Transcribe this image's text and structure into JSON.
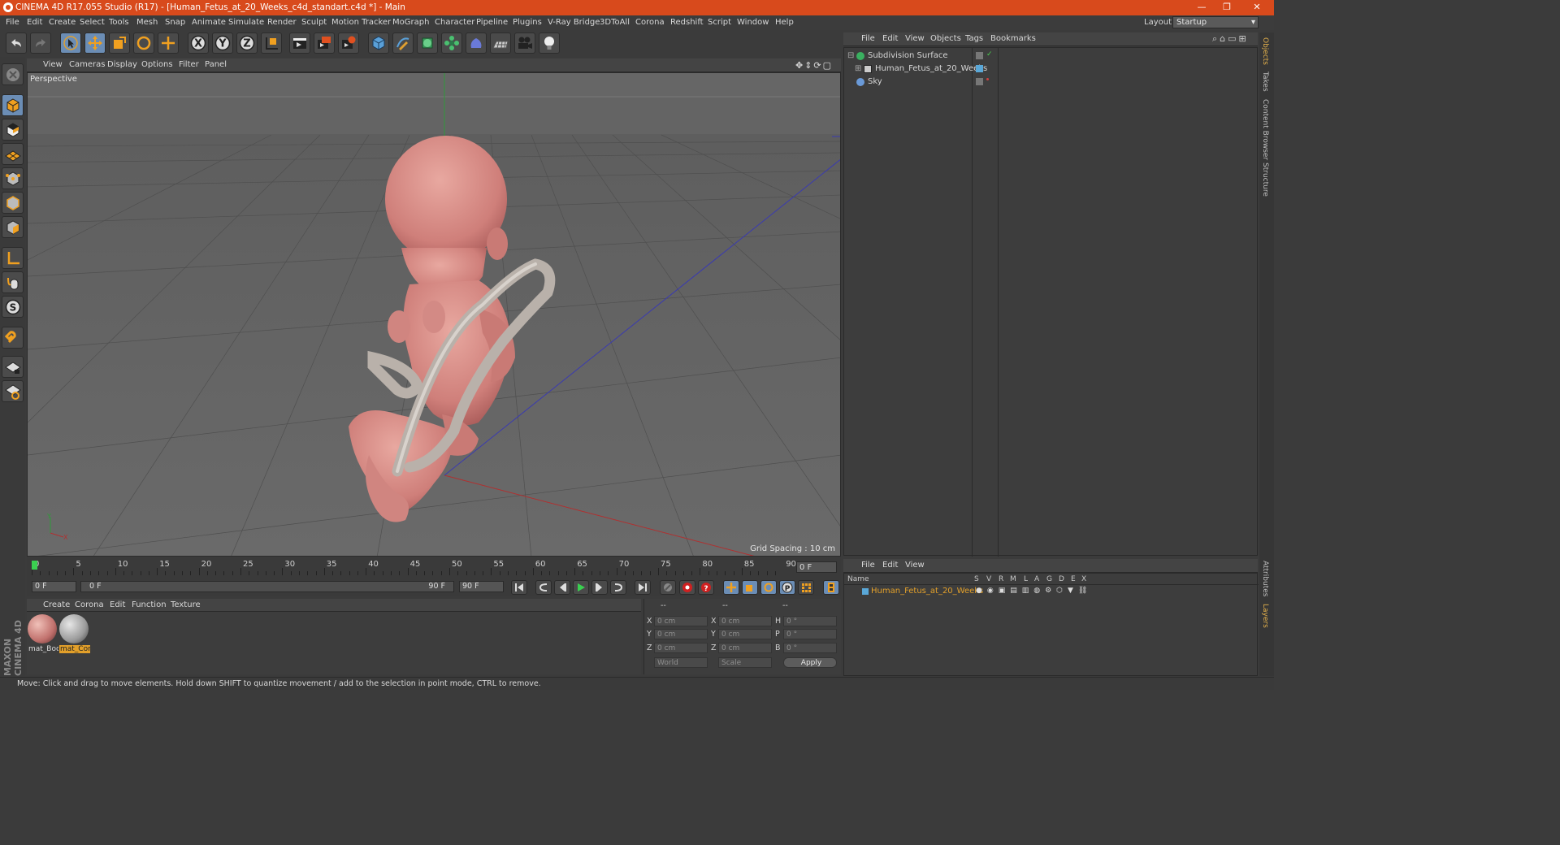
{
  "window": {
    "title": "CINEMA 4D R17.055 Studio (R17) - [Human_Fetus_at_20_Weeks_c4d_standart.c4d *] - Main",
    "minimize": "—",
    "restore": "❐",
    "close": "✕"
  },
  "menubar": {
    "items": [
      "File",
      "Edit",
      "Create",
      "Select",
      "Tools",
      "Mesh",
      "Snap",
      "Animate",
      "Simulate",
      "Render",
      "Sculpt",
      "Motion Tracker",
      "MoGraph",
      "Character",
      "Pipeline",
      "Plugins",
      "V-Ray Bridge",
      "3DToAll",
      "Corona",
      "Redshift",
      "Script",
      "Window",
      "Help"
    ],
    "layout_label": "Layout:",
    "layout_value": "Startup"
  },
  "toolbar": {
    "icons": [
      "undo-icon",
      "redo-icon",
      "select-arrow-icon",
      "move-icon",
      "scale-icon",
      "rotate-icon",
      "live-select-icon",
      "x-axis-icon",
      "y-axis-icon",
      "z-axis-icon",
      "world-coord-icon",
      "render-view-icon",
      "render-picture-icon",
      "edit-render-settings-icon",
      "cube-icon",
      "pen-spline-icon",
      "subdivision-icon",
      "array-icon",
      "deformer-icon",
      "floor-icon",
      "camera-icon",
      "light-icon"
    ]
  },
  "viewport": {
    "menu": [
      "View",
      "Cameras",
      "Display",
      "Options",
      "Filter",
      "Panel"
    ],
    "label": "Perspective",
    "grid_spacing": "Grid Spacing : 10 cm",
    "axis_y": "Y",
    "axis_x": "X"
  },
  "timeline": {
    "ticks": [
      "0",
      "5",
      "10",
      "15",
      "20",
      "25",
      "30",
      "35",
      "40",
      "45",
      "50",
      "55",
      "60",
      "65",
      "70",
      "75",
      "80",
      "85",
      "90"
    ],
    "frame_end_display": "0 F",
    "start_field": "0 F",
    "range_start": "0 F",
    "range_end": "90 F",
    "end_field": "90 F"
  },
  "materials": {
    "menu": [
      "Create",
      "Corona",
      "Edit",
      "Function",
      "Texture"
    ],
    "items": [
      {
        "name": "mat_Boc"
      },
      {
        "name": "mat_Cor"
      }
    ]
  },
  "coords": {
    "headers": [
      "--",
      "--",
      "--"
    ],
    "rows": [
      {
        "axis": "X",
        "pos": "0 cm",
        "axis2": "X",
        "size": "0 cm",
        "rlabel": "H",
        "rot": "0 °"
      },
      {
        "axis": "Y",
        "pos": "0 cm",
        "axis2": "Y",
        "size": "0 cm",
        "rlabel": "P",
        "rot": "0 °"
      },
      {
        "axis": "Z",
        "pos": "0 cm",
        "axis2": "Z",
        "size": "0 cm",
        "rlabel": "B",
        "rot": "0 °"
      }
    ],
    "mode": "World",
    "size_mode": "Scale",
    "apply": "Apply"
  },
  "status": "Move: Click and drag to move elements. Hold down SHIFT to quantize movement / add to the selection in point mode, CTRL to remove.",
  "objects": {
    "menu": [
      "File",
      "Edit",
      "View",
      "Objects",
      "Tags",
      "Bookmarks"
    ],
    "rows": [
      {
        "name": "Subdivision Surface"
      },
      {
        "name": "Human_Fetus_at_20_Weeks"
      },
      {
        "name": "Sky"
      }
    ]
  },
  "layers": {
    "menu": [
      "File",
      "Edit",
      "View"
    ],
    "columns": [
      "Name",
      "S",
      "V",
      "R",
      "M",
      "L",
      "A",
      "G",
      "D",
      "E",
      "X"
    ],
    "row_name": "Human_Fetus_at_20_Weeks"
  },
  "side_tabs": [
    "Objects",
    "Takes",
    "Content Browser",
    "Structure",
    "Attributes",
    "Layers"
  ],
  "brand": "MAXON CINEMA 4D",
  "colors": {
    "title_bar": "#d84a1c",
    "selection_blue": "#6b8db5",
    "layer_name": "#e3a02a"
  }
}
